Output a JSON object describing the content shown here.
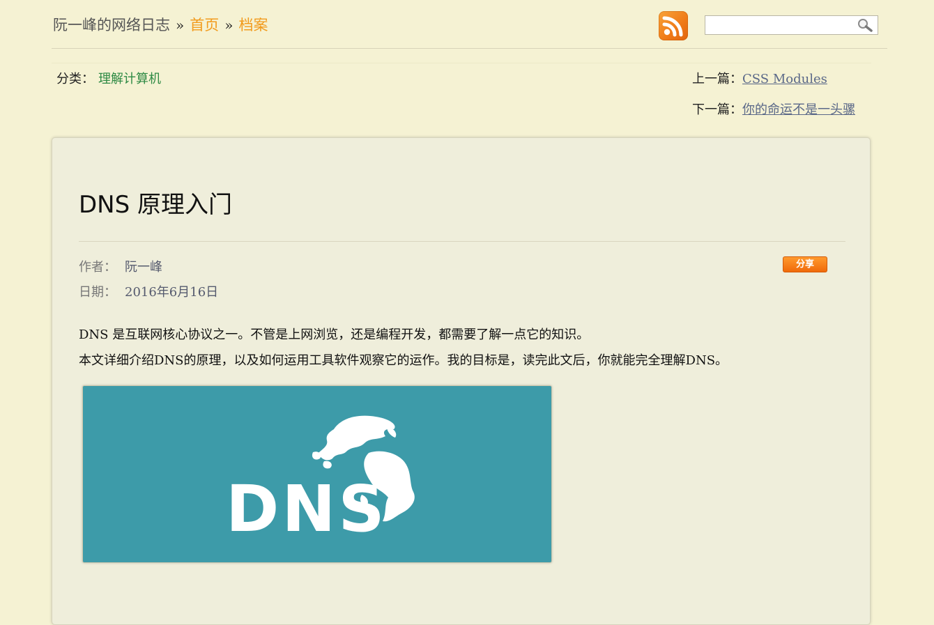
{
  "header": {
    "site_name": "阮一峰的网络日志",
    "separator": "»",
    "home_label": "首页",
    "archive_label": "档案",
    "rss_icon": "rss-feed-icon",
    "search": {
      "value": "",
      "placeholder": "",
      "icon": "magnifier-icon"
    }
  },
  "article_nav": {
    "category_label": "分类：",
    "category_value": "理解计算机",
    "prev_label": "上一篇：",
    "prev_title": "CSS Modules",
    "next_label": "下一篇：",
    "next_title": "你的命运不是一头骡"
  },
  "article": {
    "title": "DNS 原理入门",
    "author_label": "作者：",
    "author": "阮一峰",
    "date_label": "日期：",
    "date": "2016年6月16日",
    "share_label": "分享",
    "paragraphs": [
      "DNS 是互联网核心协议之一。不管是上网浏览，还是编程开发，都需要了解一点它的知识。",
      "本文详细介绍DNS的原理，以及如何运用工具软件观察它的运作。我的目标是，读完此文后，你就能完全理解DNS。"
    ],
    "figure": {
      "text": "DNS",
      "background": "#3d9ba9",
      "icon": "globe-icon"
    }
  },
  "colors": {
    "page_bg": "#f5f2d3",
    "card_bg": "#efeedb",
    "link_orange": "#f29b1c",
    "category_green": "#2e8a44",
    "nav_link": "#5a6888",
    "share_orange": "#f57d14"
  }
}
